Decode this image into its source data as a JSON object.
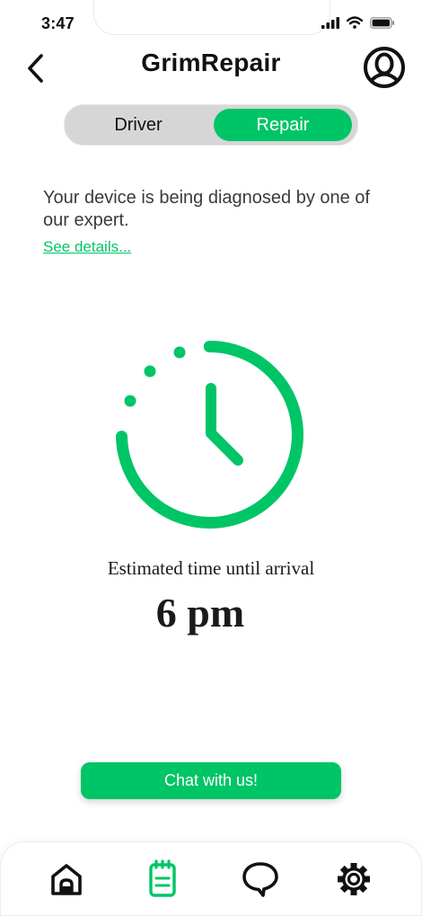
{
  "status_bar": {
    "time": "3:47"
  },
  "header": {
    "title": "GrimRepair"
  },
  "segment": {
    "driver_label": "Driver",
    "repair_label": "Repair",
    "selected": "Repair"
  },
  "info": {
    "message": "Your device is being diagnosed by one of our expert.",
    "link": "See details..."
  },
  "eta": {
    "label": "Estimated time until arrival",
    "value": "6 pm"
  },
  "chat": {
    "label": "Chat with us!"
  },
  "nav": {
    "items": [
      "home-icon",
      "notepad-icon",
      "chat-bubble-icon",
      "gear-icon"
    ],
    "active": "notepad-icon"
  },
  "colors": {
    "accent": "#00c566",
    "text": "#111111",
    "segment_bg": "#d6d6d6"
  }
}
